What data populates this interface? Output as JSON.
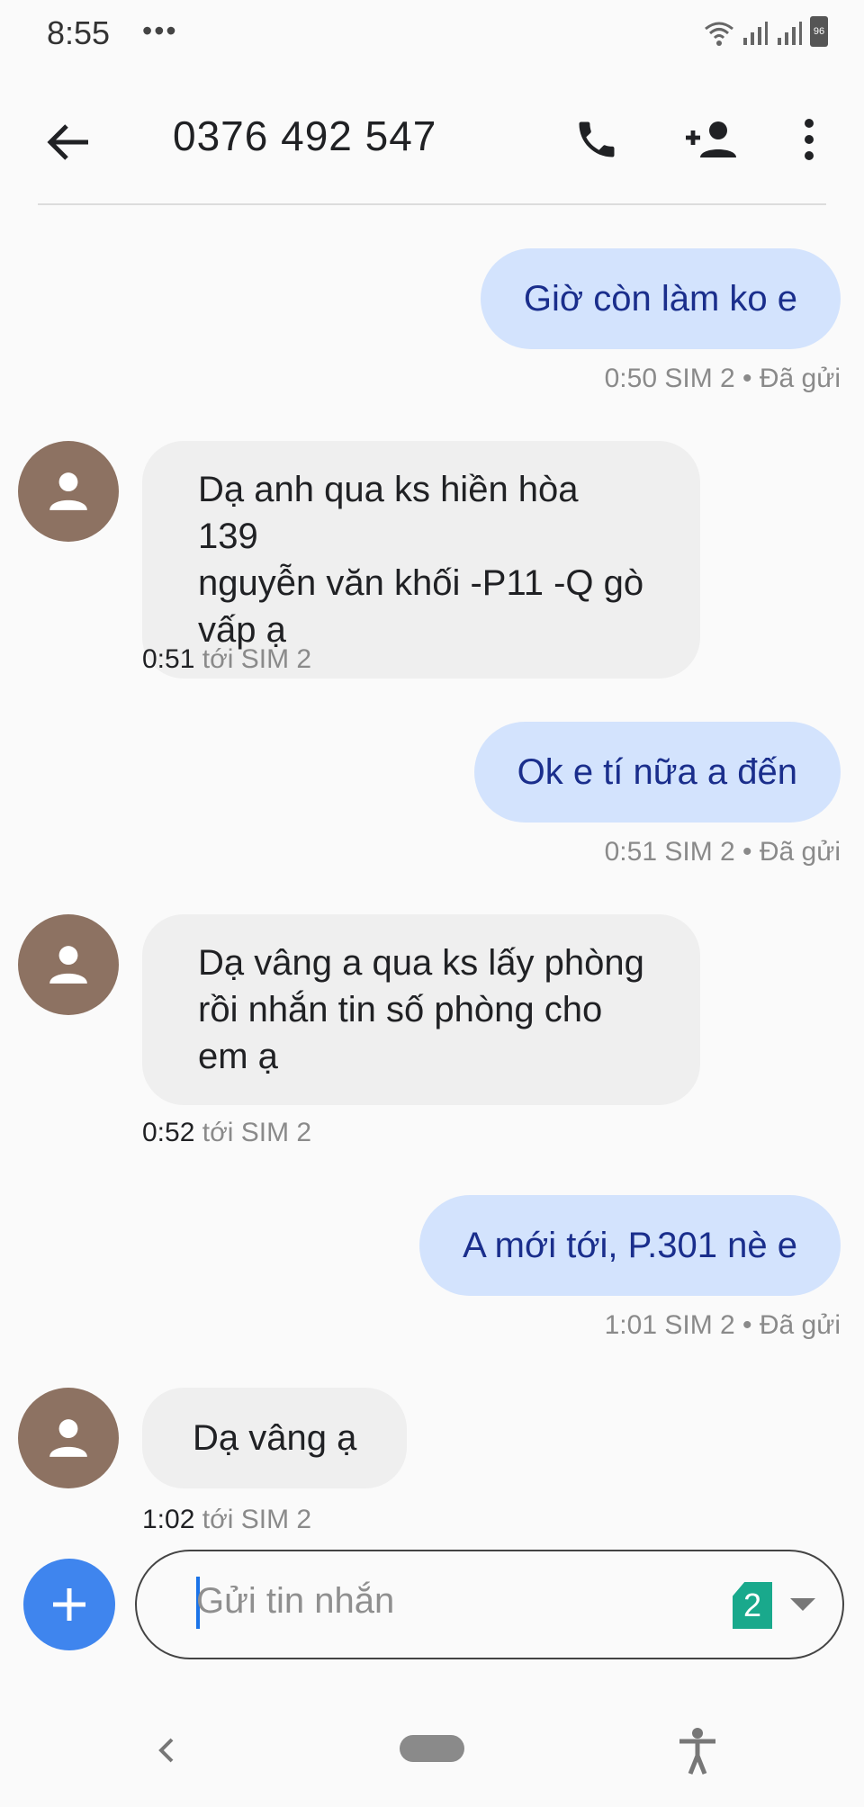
{
  "status_bar": {
    "time": "8:55",
    "more": "•••",
    "battery": "96"
  },
  "app_bar": {
    "title": "0376 492 547"
  },
  "messages": [
    {
      "direction": "out",
      "text": "Giờ còn làm ko e",
      "time": "0:50",
      "meta": "SIM 2 • Đã gửi"
    },
    {
      "direction": "in",
      "lines": [
        "Dạ anh qua ks hiền hòa 139",
        "nguyễn văn khối -P11 -Q gò",
        "vấp ạ"
      ],
      "time": "0:51",
      "meta": "tới SIM 2"
    },
    {
      "direction": "out",
      "text": "Ok e tí nữa a đến",
      "time": "0:51",
      "meta": "SIM 2 • Đã gửi"
    },
    {
      "direction": "in",
      "lines": [
        "Dạ vâng a qua ks lấy phòng",
        "rồi nhắn tin số phòng cho",
        "em ạ"
      ],
      "time": "0:52",
      "meta": "tới SIM 2"
    },
    {
      "direction": "out",
      "text": "A mới tới, P.301 nè e",
      "time": "1:01",
      "meta": "SIM 2 • Đã gửi"
    },
    {
      "direction": "in",
      "lines": [
        "Dạ vâng ạ"
      ],
      "time": "1:02",
      "meta": "tới SIM 2"
    }
  ],
  "composer": {
    "placeholder": "Gửi tin nhắn",
    "sim": "2"
  },
  "colors": {
    "outgoing_bubble": "#d3e3fd",
    "incoming_bubble": "#efefef",
    "avatar": "#8d7262",
    "fab": "#3f85ee",
    "sim_badge": "#19a98c"
  }
}
